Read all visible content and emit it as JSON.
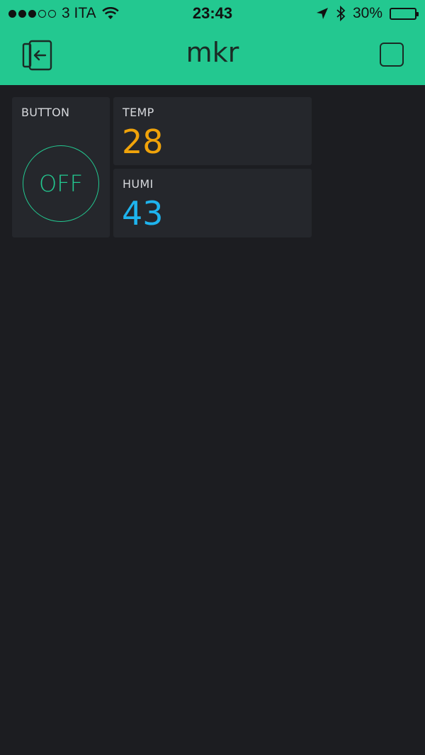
{
  "status_bar": {
    "carrier": "3 ITA",
    "time": "23:43",
    "battery_percent": "30%",
    "battery_level": 0.3,
    "signal_full": 3,
    "signal_total": 5
  },
  "nav": {
    "title": "mkr",
    "left_icon": "exit-icon",
    "right_icon": "stop-icon"
  },
  "widgets": {
    "button": {
      "label": "BUTTON",
      "state": "OFF",
      "color": "#23c890"
    },
    "temp": {
      "label": "TEMP",
      "value": "28",
      "color": "#f0a30a"
    },
    "humi": {
      "label": "HUMI",
      "value": "43",
      "color": "#1eb4ee"
    }
  },
  "colors": {
    "accent": "#23c890",
    "background": "#1c1d21",
    "widget_bg": "#25272c"
  }
}
